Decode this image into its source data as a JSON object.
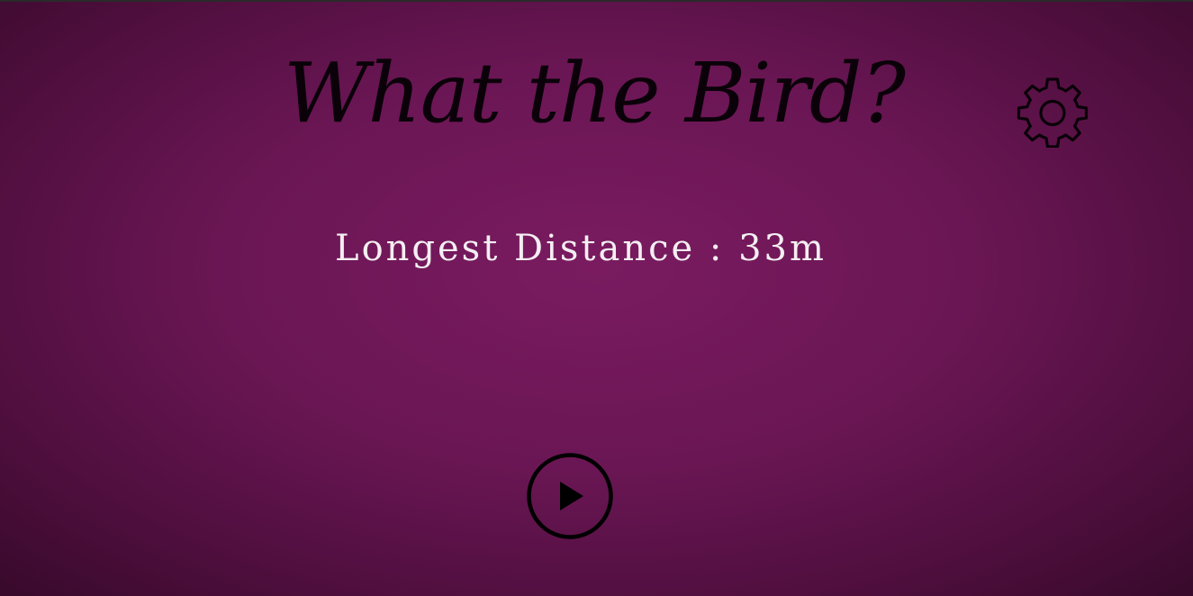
{
  "title": "What the Bird?",
  "stats": {
    "label": "Longest Distance",
    "separator": " : ",
    "value": "33m"
  },
  "icons": {
    "settings": "gear-icon",
    "play": "play-icon"
  },
  "colors": {
    "background_center": "#7a1b60",
    "background_edge": "#3a0a2d",
    "title_text": "#0b0209",
    "stat_text": "#f4eef2",
    "icon": "#000000"
  }
}
